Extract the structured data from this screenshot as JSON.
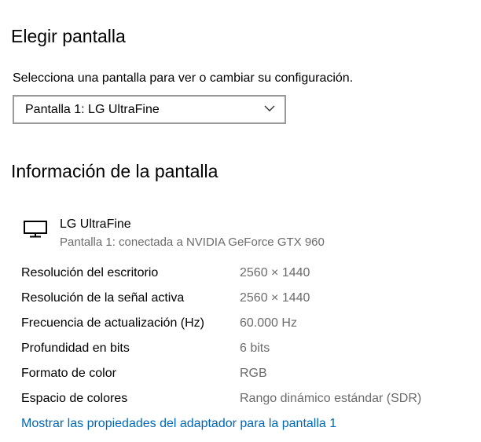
{
  "choose_display": {
    "heading": "Elegir pantalla",
    "instruction": "Selecciona una pantalla para ver o cambiar su configuración.",
    "selected_display": "Pantalla 1: LG UltraFine"
  },
  "display_info": {
    "heading": "Información de la pantalla",
    "device_name": "LG UltraFine",
    "device_connection": "Pantalla 1: conectada a NVIDIA GeForce GTX 960",
    "rows": [
      {
        "label": "Resolución del escritorio",
        "value": "2560 × 1440"
      },
      {
        "label": "Resolución de la señal activa",
        "value": "2560 × 1440"
      },
      {
        "label": "Frecuencia de actualización (Hz)",
        "value": "60.000 Hz"
      },
      {
        "label": "Profundidad en bits",
        "value": "6 bits"
      },
      {
        "label": "Formato de color",
        "value": "RGB"
      },
      {
        "label": "Espacio de colores",
        "value": "Rango dinámico estándar (SDR)"
      }
    ],
    "adapter_link": "Mostrar las propiedades del adaptador para la pantalla 1"
  },
  "icons": {
    "monitor": "monitor-icon",
    "dropdown": "chevron-down-icon"
  },
  "colors": {
    "link": "#0067b8",
    "secondary_text": "#6b6b6b",
    "dropdown_border": "#999999"
  }
}
